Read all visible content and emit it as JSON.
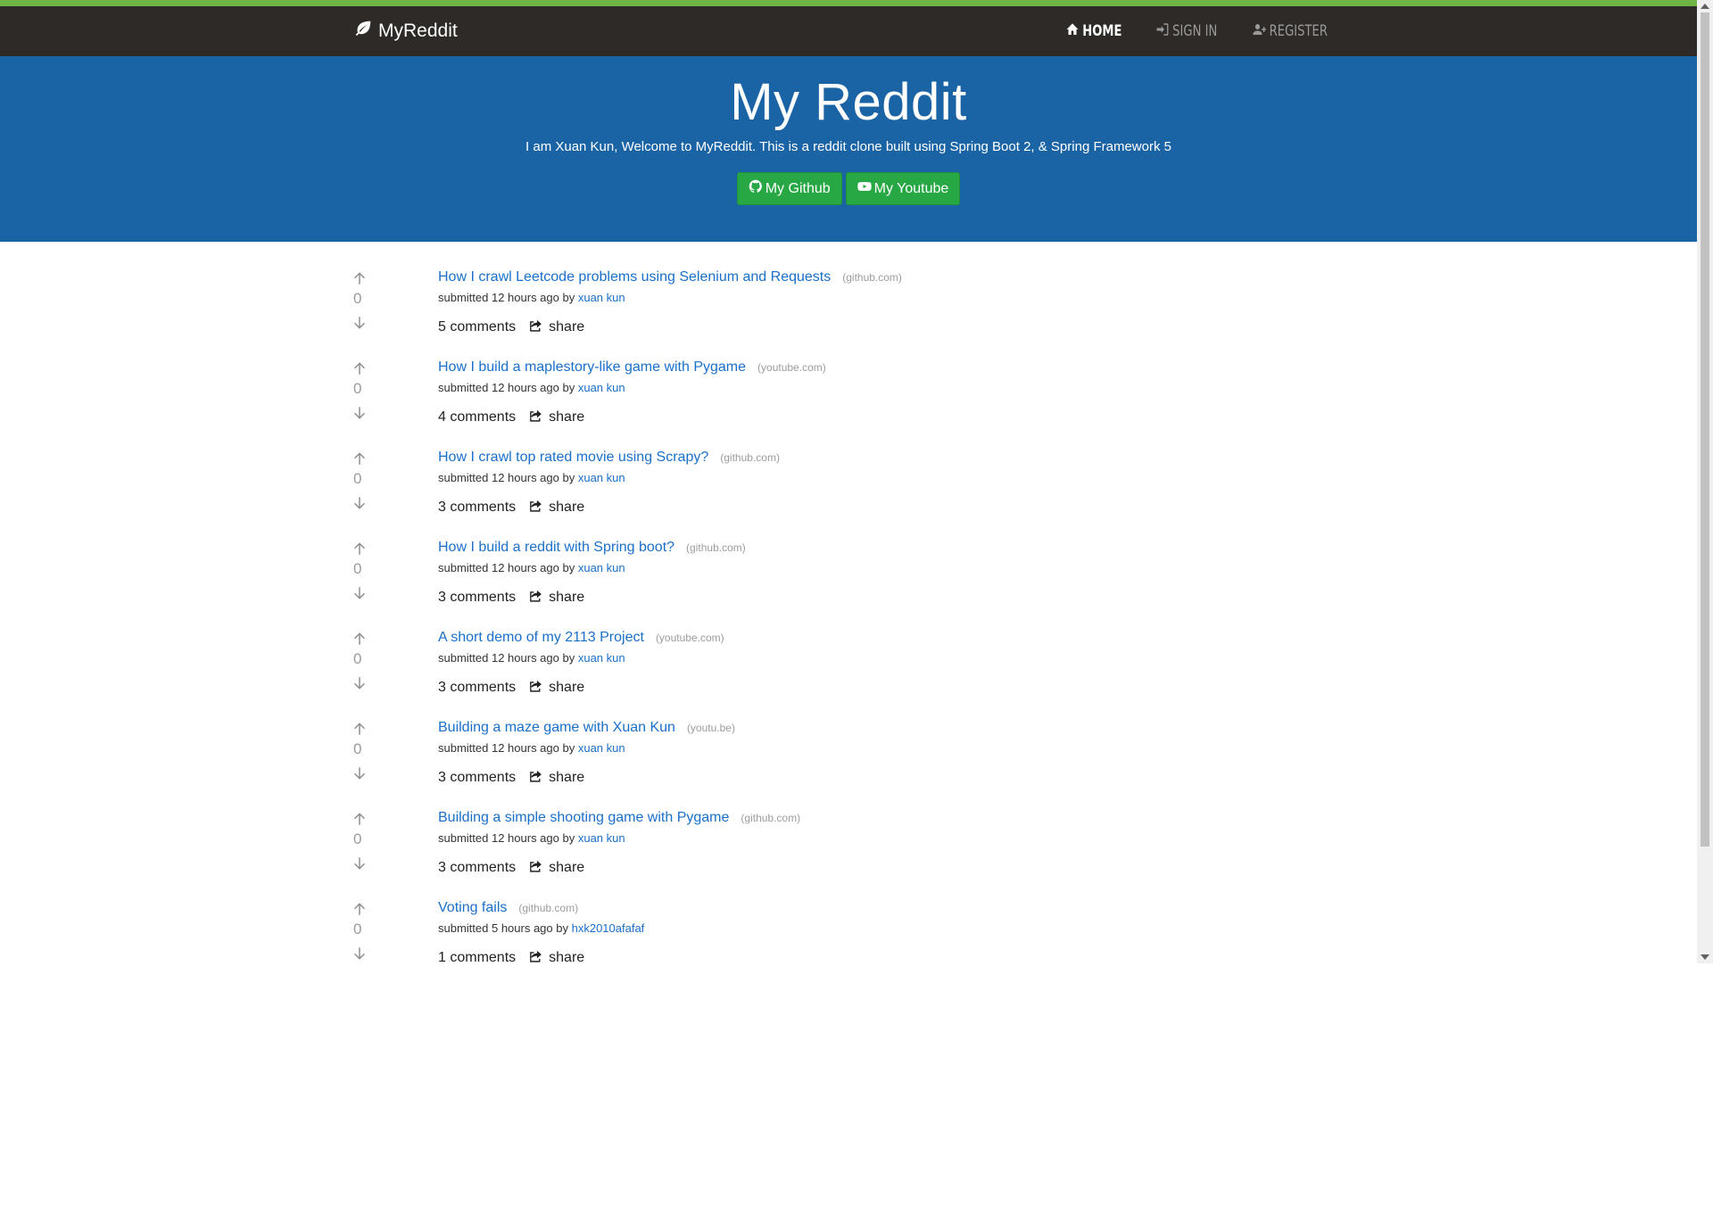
{
  "navbar": {
    "brand": "MyReddit",
    "links": [
      {
        "label": "HOME",
        "icon": "home-icon",
        "active": true
      },
      {
        "label": "SIGN IN",
        "icon": "sign-in-icon",
        "active": false
      },
      {
        "label": "REGISTER",
        "icon": "user-plus-icon",
        "active": false
      }
    ]
  },
  "hero": {
    "title": "My Reddit",
    "subtitle": "I am Xuan Kun, Welcome to MyReddit. This is a reddit clone built using Spring Boot 2, & Spring Framework 5",
    "github_label": "My Github",
    "youtube_label": "My Youtube"
  },
  "share_label": "share",
  "posts": [
    {
      "score": "0",
      "title": "How I crawl Leetcode problems using Selenium and Requests",
      "domain": "(github.com)",
      "submitted": "submitted 12 hours ago by",
      "author": "xuan kun",
      "comments": "5 comments"
    },
    {
      "score": "0",
      "title": "How I build a maplestory-like game with Pygame",
      "domain": "(youtube.com)",
      "submitted": "submitted 12 hours ago by",
      "author": "xuan kun",
      "comments": "4 comments"
    },
    {
      "score": "0",
      "title": "How I crawl top rated movie using Scrapy?",
      "domain": "(github.com)",
      "submitted": "submitted 12 hours ago by",
      "author": "xuan kun",
      "comments": "3 comments"
    },
    {
      "score": "0",
      "title": "How I build a reddit with Spring boot?",
      "domain": "(github.com)",
      "submitted": "submitted 12 hours ago by",
      "author": "xuan kun",
      "comments": "3 comments"
    },
    {
      "score": "0",
      "title": "A short demo of my 2113 Project",
      "domain": "(youtube.com)",
      "submitted": "submitted 12 hours ago by",
      "author": "xuan kun",
      "comments": "3 comments"
    },
    {
      "score": "0",
      "title": "Building a maze game with Xuan Kun",
      "domain": "(youtu.be)",
      "submitted": "submitted 12 hours ago by",
      "author": "xuan kun",
      "comments": "3 comments"
    },
    {
      "score": "0",
      "title": "Building a simple shooting game with Pygame",
      "domain": "(github.com)",
      "submitted": "submitted 12 hours ago by",
      "author": "xuan kun",
      "comments": "3 comments"
    },
    {
      "score": "0",
      "title": "Voting fails",
      "domain": "(github.com)",
      "submitted": "submitted 5 hours ago by",
      "author": "hxk2010afafaf",
      "comments": "1 comments"
    }
  ]
}
